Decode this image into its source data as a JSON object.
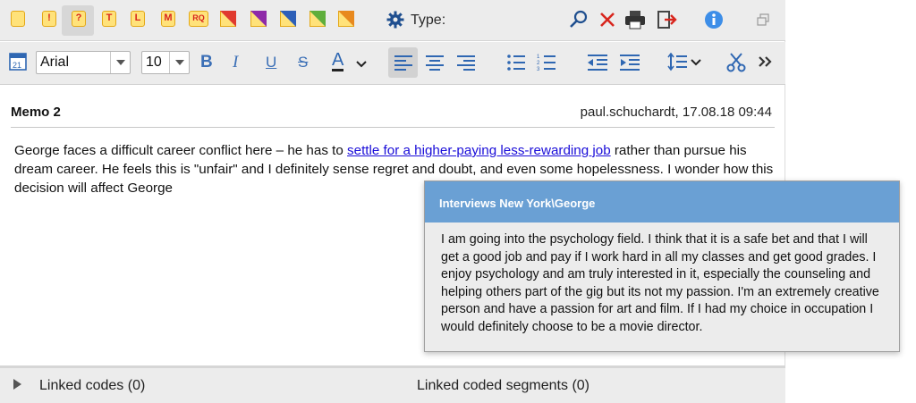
{
  "toolbar": {
    "memo_icons": [
      {
        "name": "memo-plain-icon",
        "label": ""
      },
      {
        "name": "memo-exclamation-icon",
        "label": "!"
      },
      {
        "name": "memo-question-icon",
        "label": "?"
      },
      {
        "name": "memo-t-icon",
        "label": "T"
      },
      {
        "name": "memo-l-icon",
        "label": "L"
      },
      {
        "name": "memo-m-icon",
        "label": "M"
      },
      {
        "name": "memo-rq-icon",
        "label": "RQ"
      }
    ],
    "type_label": "Type:",
    "colors": {
      "accent_blue": "#2f67b2",
      "delete_red": "#d8261e",
      "info_blue": "#3d8ee8"
    }
  },
  "format": {
    "font": "Arial",
    "size": "10",
    "bold": "B",
    "italic": "I",
    "underline": "U",
    "strike": "S",
    "color_a": "A"
  },
  "memo": {
    "title": "Memo 2",
    "meta": "paul.schuchardt, 17.08.18 09:44",
    "text_before": "George faces a difficult career conflict here – he has to ",
    "link": "settle for a higher-paying less-rewarding job",
    "text_after": " rather than pursue his dream career. He feels this is \"unfair\" and I definitely sense regret and doubt, and even some hopelessness. I wonder how this decision will affect George"
  },
  "popup": {
    "title": "Interviews New York\\George",
    "body": "I am going into the psychology field. I think that it is a safe bet and that I will get a good job and pay if I work hard in all my classes and get good grades. I enjoy psychology and am truly interested in it, especially the counseling and helping others part of the gig but its not my passion. I'm an extremely creative person and have a passion for art and film. If I had my choice in occupation I would definitely choose to be a movie director."
  },
  "bottom": {
    "linked_codes": "Linked codes (0)",
    "linked_segments": "Linked coded segments (0)"
  }
}
